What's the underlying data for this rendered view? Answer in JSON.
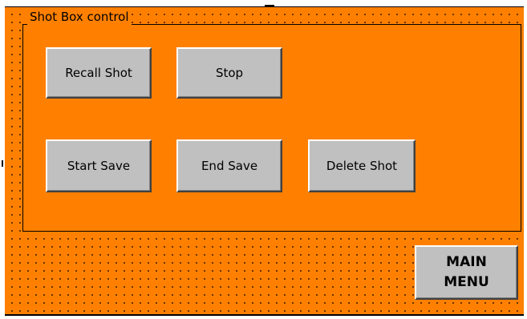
{
  "groupbox": {
    "caption": "Shot Box control"
  },
  "buttons": {
    "recall_shot": "Recall Shot",
    "stop": "Stop",
    "start_save": "Start Save",
    "end_save": "End Save",
    "delete_shot": "Delete Shot"
  },
  "main_menu": {
    "line1": "MAIN",
    "line2": "MENU"
  },
  "colors": {
    "canvas_background": "#ff8000",
    "button_face": "#c0c0c0"
  }
}
